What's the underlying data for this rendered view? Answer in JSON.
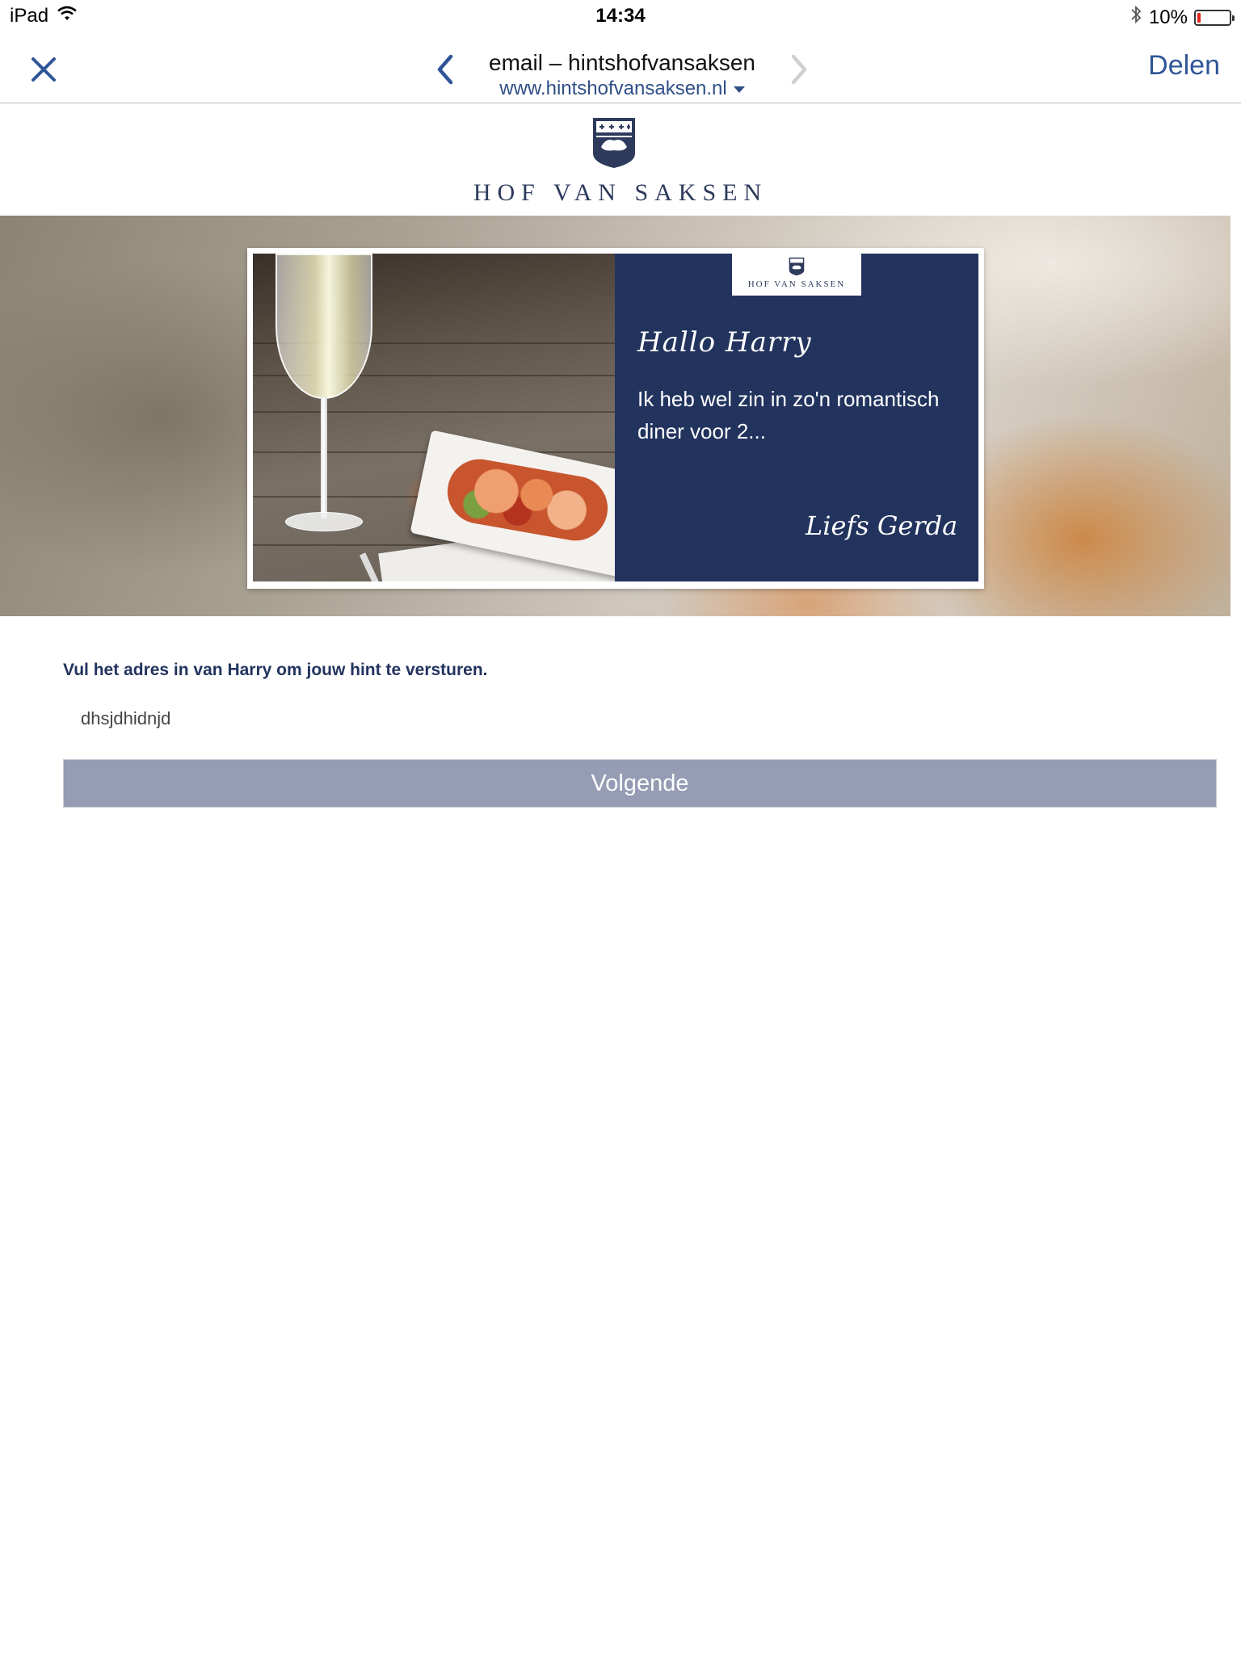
{
  "status_bar": {
    "device": "iPad",
    "time": "14:34",
    "battery_percent": "10%",
    "battery_level": 0.1
  },
  "nav": {
    "title": "email – hintshofvansaksen",
    "url": "www.hintshofvansaksen.nl",
    "share_label": "Delen",
    "accent_color": "#2f5597"
  },
  "header": {
    "brand_name": "HOF VAN SAKSEN"
  },
  "hero_card": {
    "brand_name": "HOF VAN SAKSEN",
    "greeting": "Hallo Harry",
    "message": "Ik heb wel zin in zo'n romantisch diner voor 2...",
    "signature": "Liefs Gerda",
    "panel_color": "#22335e"
  },
  "form": {
    "label": "Vul het adres in van Harry om jouw hint te versturen.",
    "input_value": "dhsjdhidnjd",
    "next_button_label": "Volgende",
    "button_color": "#969cb3"
  }
}
